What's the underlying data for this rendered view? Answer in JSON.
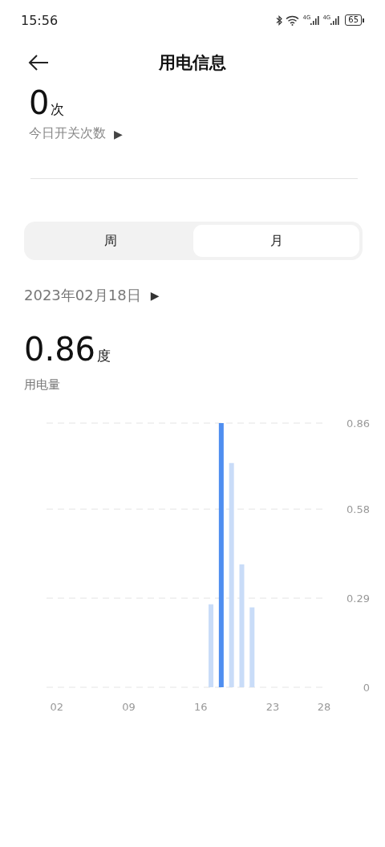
{
  "status_bar": {
    "time": "15:56",
    "network_labels": [
      "4G",
      "4G"
    ],
    "battery": "65"
  },
  "header": {
    "title": "用电信息"
  },
  "switch_count": {
    "value": "0",
    "unit": "次",
    "label": "今日开关次数",
    "arrow": "▶"
  },
  "tabs": [
    {
      "label": "周",
      "selected": false
    },
    {
      "label": "月",
      "selected": true
    }
  ],
  "date": {
    "text": "2023年02月18日",
    "arrow": "▶"
  },
  "usage": {
    "value": "0.86",
    "unit": "度",
    "label": "用电量"
  },
  "chart_data": {
    "type": "bar",
    "xlim": [
      1,
      28
    ],
    "x": [
      17,
      18,
      19,
      20,
      21
    ],
    "series": [
      {
        "color": "#c9dcf8",
        "values": [
          0.27,
          null,
          0.73,
          0.4,
          0.26
        ]
      },
      {
        "color": "#4f8ef0",
        "values": [
          null,
          0.86,
          null,
          null,
          null
        ]
      }
    ],
    "ylim": [
      0,
      0.86
    ],
    "xticks": [
      {
        "value": 2,
        "label": "02"
      },
      {
        "value": 9,
        "label": "09"
      },
      {
        "value": 16,
        "label": "16"
      },
      {
        "value": 23,
        "label": "23"
      },
      {
        "value": 28,
        "label": "28"
      }
    ],
    "yticks": [
      {
        "value": 0,
        "label": "0"
      },
      {
        "value": 0.29,
        "label": "0.29"
      },
      {
        "value": 0.58,
        "label": "0.58"
      },
      {
        "value": 0.86,
        "label": "0.86"
      }
    ]
  }
}
